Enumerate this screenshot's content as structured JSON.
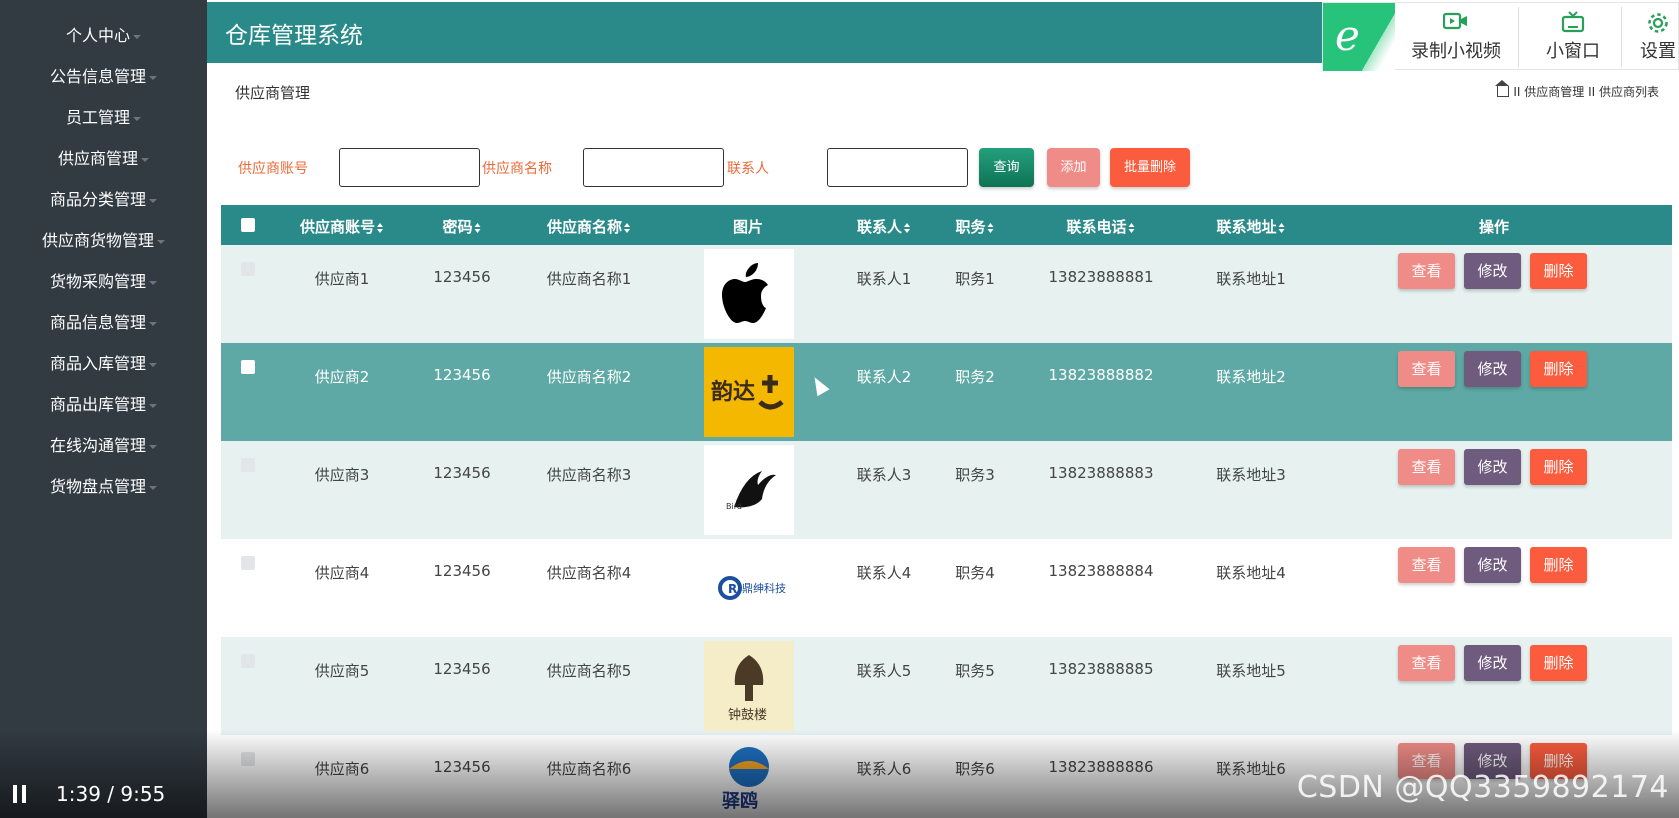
{
  "sidebar": {
    "items": [
      {
        "label": "个人中心"
      },
      {
        "label": "公告信息管理"
      },
      {
        "label": "员工管理"
      },
      {
        "label": "供应商管理"
      },
      {
        "label": "商品分类管理"
      },
      {
        "label": "供应商货物管理"
      },
      {
        "label": "货物采购管理"
      },
      {
        "label": "商品信息管理"
      },
      {
        "label": "商品入库管理"
      },
      {
        "label": "商品出库管理"
      },
      {
        "label": "在线沟通管理"
      },
      {
        "label": "货物盘点管理"
      }
    ]
  },
  "header": {
    "title": "仓库管理系统"
  },
  "overlay": {
    "record_label": "录制小视频",
    "window_label": "小窗口",
    "settings_label": "设置"
  },
  "page": {
    "title": "供应商管理"
  },
  "breadcrumb": {
    "text": "II 供应商管理 II 供应商列表"
  },
  "search": {
    "account_label": "供应商账号",
    "name_label": "供应商名称",
    "contact_label": "联系人",
    "query_button": "查询",
    "add_button": "添加",
    "batch_delete_button": "批量删除"
  },
  "table": {
    "headers": {
      "account": "供应商账号",
      "password": "密码",
      "name": "供应商名称",
      "image": "图片",
      "contact": "联系人",
      "position": "职务",
      "phone": "联系电话",
      "address": "联系地址",
      "actions": "操作"
    },
    "action_labels": {
      "view": "查看",
      "edit": "修改",
      "delete": "删除"
    },
    "rows": [
      {
        "account": "供应商1",
        "password": "123456",
        "name": "供应商名称1",
        "contact": "联系人1",
        "position": "职务1",
        "phone": "13823888881",
        "address": "联系地址1"
      },
      {
        "account": "供应商2",
        "password": "123456",
        "name": "供应商名称2",
        "contact": "联系人2",
        "position": "职务2",
        "phone": "13823888882",
        "address": "联系地址2"
      },
      {
        "account": "供应商3",
        "password": "123456",
        "name": "供应商名称3",
        "contact": "联系人3",
        "position": "职务3",
        "phone": "13823888883",
        "address": "联系地址3"
      },
      {
        "account": "供应商4",
        "password": "123456",
        "name": "供应商名称4",
        "contact": "联系人4",
        "position": "职务4",
        "phone": "13823888884",
        "address": "联系地址4"
      },
      {
        "account": "供应商5",
        "password": "123456",
        "name": "供应商名称5",
        "contact": "联系人5",
        "position": "职务5",
        "phone": "13823888885",
        "address": "联系地址5"
      },
      {
        "account": "供应商6",
        "password": "123456",
        "name": "供应商名称6",
        "contact": "联系人6",
        "position": "职务6",
        "phone": "13823888886",
        "address": "联系地址6"
      }
    ],
    "row_images": [
      "apple-logo",
      "yunda-logo",
      "bird-logo",
      "dingshen-tech-logo",
      "tower-logo",
      "yiyi-logo"
    ]
  },
  "logo_text": {
    "yunda": "韵达",
    "dingshen": "鼎绅科技",
    "tower": "钟鼓楼",
    "yiyi": "驿鸥"
  },
  "video": {
    "time": "1:39 / 9:55"
  },
  "watermark": "CSDN @QQ3359892174",
  "colors": {
    "sidebar_bg": "#323a42",
    "header_bg": "#2a8a89",
    "label_orange": "#e96b3a",
    "query_btn": "#1b8a6b",
    "add_btn": "#f08c87",
    "batch_delete_btn": "#fb5c3e",
    "view_btn": "#f08c87",
    "edit_btn": "#6f5b7d",
    "delete_btn": "#fb5c3e",
    "row_alt": "#e6f1f0",
    "row_selected": "#5ea9a5"
  }
}
